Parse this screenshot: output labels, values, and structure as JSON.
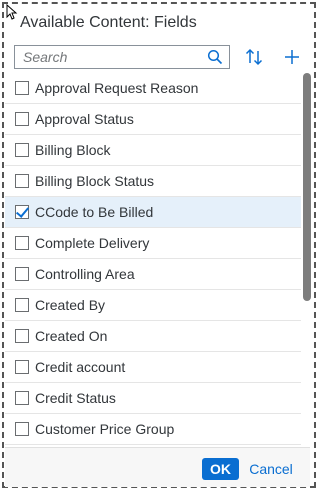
{
  "dialog": {
    "title": "Available Content: Fields"
  },
  "search": {
    "placeholder": "Search",
    "value": ""
  },
  "toolbar": {
    "sort_icon": "sort-icon",
    "add_icon": "add-icon"
  },
  "fields": [
    {
      "label": "Approval Request Reason",
      "checked": false
    },
    {
      "label": "Approval Status",
      "checked": false
    },
    {
      "label": "Billing Block",
      "checked": false
    },
    {
      "label": "Billing Block Status",
      "checked": false
    },
    {
      "label": "CCode to Be Billed",
      "checked": true
    },
    {
      "label": "Complete Delivery",
      "checked": false
    },
    {
      "label": "Controlling Area",
      "checked": false
    },
    {
      "label": "Created By",
      "checked": false
    },
    {
      "label": "Created On",
      "checked": false
    },
    {
      "label": "Credit account",
      "checked": false
    },
    {
      "label": "Credit Status",
      "checked": false
    },
    {
      "label": "Customer Price Group",
      "checked": false
    }
  ],
  "footer": {
    "ok_label": "OK",
    "cancel_label": "Cancel"
  },
  "colors": {
    "accent": "#0a6ed1",
    "selected_row": "#e5f0fa",
    "text": "#32363a"
  }
}
